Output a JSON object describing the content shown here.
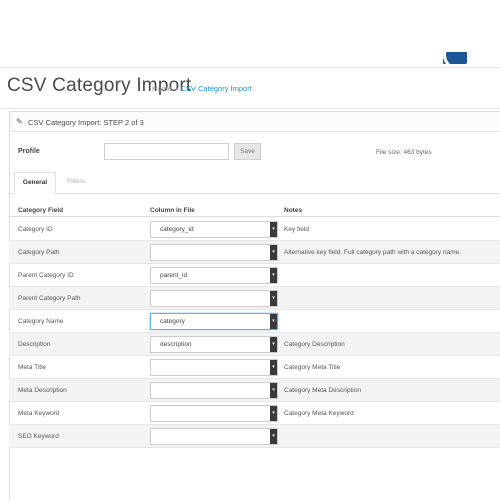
{
  "page": {
    "title": "CSV Category Import",
    "breadcrumb": [
      {
        "label": "Home"
      },
      {
        "label": "CSV Category Import"
      }
    ]
  },
  "panel": {
    "title": "CSV Category Import: STEP 2 of 3",
    "icon": "pencil-icon"
  },
  "profile": {
    "label": "Profile",
    "value": "",
    "save_label": "Save",
    "file_size": "File size: 463 bytes"
  },
  "tabs": [
    {
      "label": "General",
      "active": true
    },
    {
      "label": "Filters",
      "active": false
    }
  ],
  "table": {
    "headers": [
      "Category Field",
      "Column in File",
      "Notes"
    ],
    "rows": [
      {
        "field": "Category ID",
        "column": "category_id",
        "note": "Key field"
      },
      {
        "field": "Category Path",
        "column": "",
        "note": "Alternative key field. Full category path with a category name."
      },
      {
        "field": "Parent Category ID",
        "column": "parent_id",
        "note": ""
      },
      {
        "field": "Parent Category Path",
        "column": "",
        "note": ""
      },
      {
        "field": "Category Name",
        "column": "category",
        "note": ""
      },
      {
        "field": "Description",
        "column": "description",
        "note": "Category Description"
      },
      {
        "field": "Meta Title",
        "column": "",
        "note": "Category Meta Title"
      },
      {
        "field": "Meta Description",
        "column": "",
        "note": "Category Meta Description"
      },
      {
        "field": "Meta Keyword",
        "column": "",
        "note": "Category Meta Keyword"
      },
      {
        "field": "SEO Keyword",
        "column": "",
        "note": ""
      }
    ]
  },
  "colors": {
    "link": "#1e91cf",
    "focus": "#66afe9"
  }
}
